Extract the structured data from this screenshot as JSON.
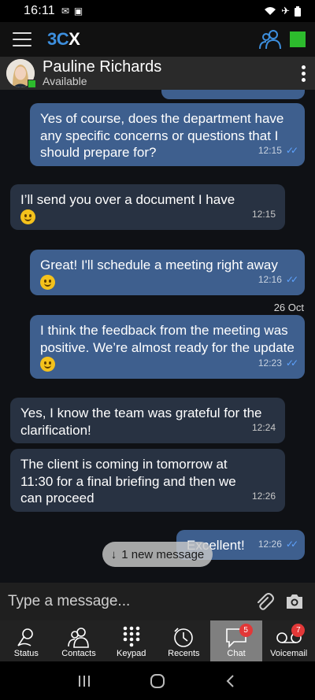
{
  "status_bar": {
    "time": "16:11",
    "left_icons": "✉ ▣",
    "right_icons": "✈"
  },
  "header": {
    "logo_3": "3",
    "logo_c": "C",
    "logo_x": "X"
  },
  "contact": {
    "name": "Pauline Richards",
    "status": "Available"
  },
  "messages": [
    {
      "dir": "out",
      "text": "Yes of course, does the department have any specific concerns or questions that I should prepare for?",
      "time": "12:15",
      "read": true
    },
    {
      "dir": "in",
      "text": "I’ll send you over a document I have",
      "emoji": true,
      "time": "12:15"
    },
    {
      "dir": "out",
      "text": "Great! I'll schedule a meeting right away",
      "emoji": true,
      "time": "12:16",
      "read": true
    },
    {
      "dir": "out",
      "text": "I think the feedback from the meeting was positive. We’re almost ready for the update",
      "emoji": true,
      "time": "12:23",
      "read": true
    },
    {
      "dir": "in",
      "text": "Yes, I know the team was grateful for the clarification!",
      "time": "12:24"
    },
    {
      "dir": "in",
      "text": "The client is coming in tomorrow at 11:30 for a final briefing and then we can proceed",
      "time": "12:26"
    },
    {
      "dir": "out",
      "text": "Excellent!",
      "time": "12:26",
      "read": true
    }
  ],
  "date_separator": "26 Oct",
  "new_message_pill": {
    "arrow": "↓",
    "label": "1 new message"
  },
  "composer": {
    "placeholder": "Type a message..."
  },
  "nav": {
    "items": [
      {
        "label": "Status"
      },
      {
        "label": "Contacts"
      },
      {
        "label": "Keypad"
      },
      {
        "label": "Recents"
      },
      {
        "label": "Chat",
        "badge": "5",
        "active": true
      },
      {
        "label": "Voicemail",
        "badge": "7"
      }
    ]
  },
  "colors": {
    "outgoing_bubble": "#3e5f8e",
    "incoming_bubble": "#283242",
    "accent": "#3d8fde",
    "available": "#2dbb2d",
    "badge": "#e23838"
  }
}
